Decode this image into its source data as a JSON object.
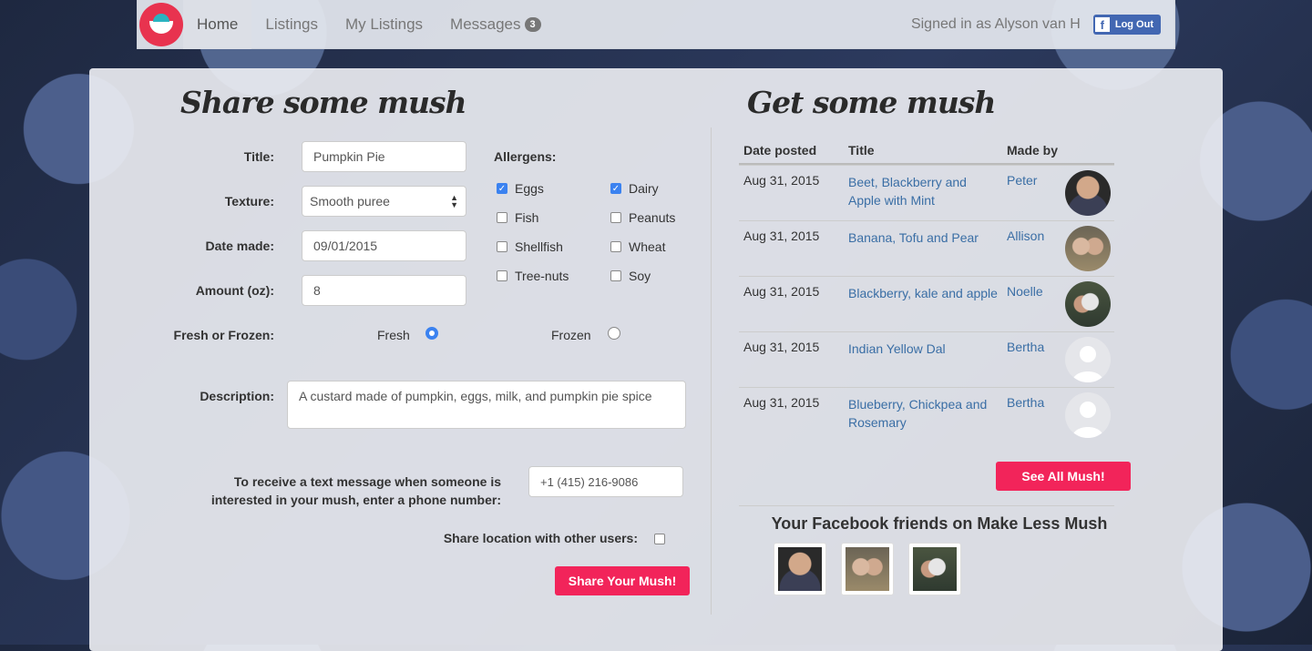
{
  "nav": {
    "items": [
      "Home",
      "Listings",
      "My Listings",
      "Messages"
    ],
    "messages_count": "3",
    "signed_in": "Signed in as Alyson van H",
    "fb_logout": "Log Out"
  },
  "share": {
    "heading": "Share some mush",
    "title_label": "Title:",
    "title_value": "Pumpkin Pie",
    "texture_label": "Texture:",
    "texture_value": "Smooth puree",
    "date_label": "Date made:",
    "date_value": "09/01/2015",
    "amount_label": "Amount (oz):",
    "amount_value": "8",
    "fresh_frozen_label": "Fresh or Frozen:",
    "fresh_label": "Fresh",
    "frozen_label": "Frozen",
    "fresh_selected": true,
    "allergens_label": "Allergens:",
    "allergens": [
      {
        "label": "Eggs",
        "checked": true
      },
      {
        "label": "Dairy",
        "checked": true
      },
      {
        "label": "Fish",
        "checked": false
      },
      {
        "label": "Peanuts",
        "checked": false
      },
      {
        "label": "Shellfish",
        "checked": false
      },
      {
        "label": "Wheat",
        "checked": false
      },
      {
        "label": "Tree-nuts",
        "checked": false
      },
      {
        "label": "Soy",
        "checked": false
      }
    ],
    "description_label": "Description:",
    "description_value": "A custard made of pumpkin, eggs, milk, and pumpkin pie spice",
    "phone_label": "To receive a text message when someone is interested in your mush, enter a phone number:",
    "phone_value": "+1 (415) 216-9086",
    "share_location_label": "Share location with other users:",
    "share_location_checked": false,
    "submit_label": "Share Your Mush!"
  },
  "get": {
    "heading": "Get some mush",
    "columns": [
      "Date posted",
      "Title",
      "Made by"
    ],
    "rows": [
      {
        "date": "Aug 31, 2015",
        "title": "Beet, Blackberry and Apple with Mint",
        "maker": "Peter"
      },
      {
        "date": "Aug 31, 2015",
        "title": "Banana, Tofu and Pear",
        "maker": "Allison"
      },
      {
        "date": "Aug 31, 2015",
        "title": "Blackberry, kale and apple",
        "maker": "Noelle"
      },
      {
        "date": "Aug 31, 2015",
        "title": "Indian Yellow Dal",
        "maker": "Bertha"
      },
      {
        "date": "Aug 31, 2015",
        "title": "Blueberry, Chickpea and Rosemary",
        "maker": "Bertha"
      }
    ],
    "see_all_label": "See All Mush!",
    "friends_title": "Your Facebook friends on Make Less Mush"
  },
  "colors": {
    "accent": "#f2245a",
    "link": "#3a6ea5",
    "facebook": "#4267b2",
    "checkbox": "#3b82f0"
  }
}
